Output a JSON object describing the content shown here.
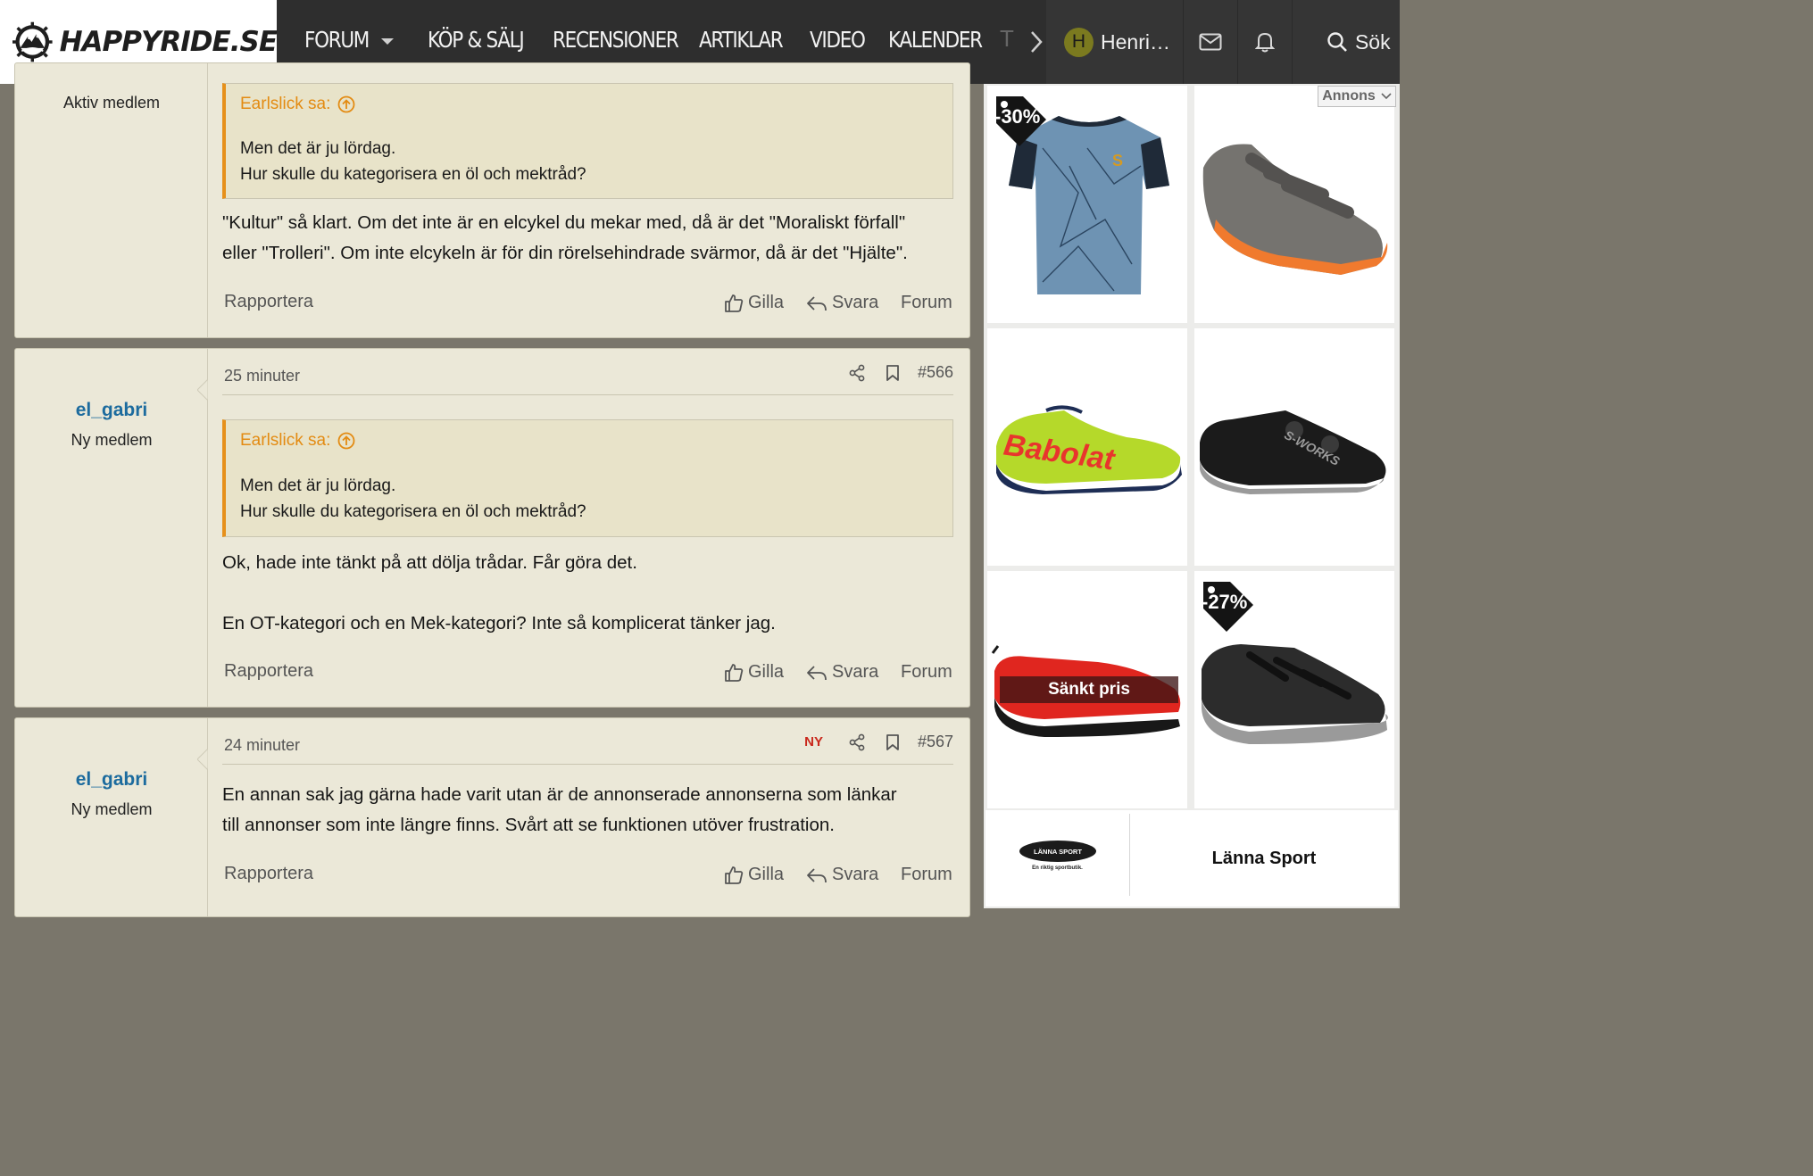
{
  "site": {
    "logo_text": "HAPPYRIDE.SE"
  },
  "nav": {
    "items": [
      "FORUM",
      "KÖP & SÄLJ",
      "RECENSIONER",
      "ARTIKLAR",
      "VIDEO",
      "KALENDER"
    ],
    "overflow_char": "T"
  },
  "header": {
    "user_initial": "H",
    "user_name": "Henri…",
    "search_label": "Sök"
  },
  "posts": [
    {
      "user_title": "Aktiv medlem",
      "quote_author": "Earlslick sa:",
      "quote_lines": [
        "Men det är ju lördag.",
        "Hur skulle du kategorisera en öl och mektråd?"
      ],
      "body": [
        "\"Kultur\" så klart. Om det inte är en elcykel du mekar med, då är det \"Moraliskt förfall\"",
        "eller \"Trolleri\". Om inte elcykeln är för din rörelsehindrade svärmor, då är det \"Hjälte\"."
      ],
      "actions": {
        "report": "Rapportera",
        "like": "Gilla",
        "reply": "Svara",
        "forum": "Forum"
      }
    },
    {
      "user": "el_gabri",
      "user_title": "Ny medlem",
      "time": "25 minuter",
      "number": "#566",
      "quote_author": "Earlslick sa:",
      "quote_lines": [
        "Men det är ju lördag.",
        "Hur skulle du kategorisera en öl och mektråd?"
      ],
      "body": [
        "Ok, hade inte tänkt på att dölja trådar. Får göra det.",
        "En OT-kategori och en Mek-kategori? Inte så komplicerat tänker jag."
      ],
      "actions": {
        "report": "Rapportera",
        "like": "Gilla",
        "reply": "Svara",
        "forum": "Forum"
      }
    },
    {
      "user": "el_gabri",
      "user_title": "Ny medlem",
      "time": "24 minuter",
      "new_badge": "NY",
      "number": "#567",
      "body": [
        "En annan sak jag gärna hade varit utan är de annonserade annonserna som länkar",
        "till annonser som inte längre finns. Svårt att se funktionen utöver frustration."
      ],
      "actions": {
        "report": "Rapportera",
        "like": "Gilla",
        "reply": "Svara",
        "forum": "Forum"
      }
    }
  ],
  "ads": {
    "label": "Annons",
    "tiles": [
      {
        "product": "blue-geometric-jersey",
        "discount": "-30%"
      },
      {
        "product": "grey-orange-velcro-shoe"
      },
      {
        "product": "yellow-babolat-shoe",
        "brand_text": "Babolat"
      },
      {
        "product": "black-s-works-shoe",
        "brand_text": "S-WORKS"
      },
      {
        "product": "red-shoe",
        "banner": "Sänkt pris"
      },
      {
        "product": "black-grey-mtb-shoe",
        "discount": "-27%"
      }
    ],
    "store_logo_text": "LÄNNA SPORT",
    "store_tagline": "En riktig sportbutik.",
    "store_name": "Länna Sport"
  },
  "colors": {
    "header_bg": "#2e2e2e",
    "nav_active": "#5c9a3e",
    "post_bg": "#ebe8d8",
    "quote_accent": "#e6901b",
    "user_link": "#1c6b9e",
    "new_badge": "#c9271b"
  }
}
